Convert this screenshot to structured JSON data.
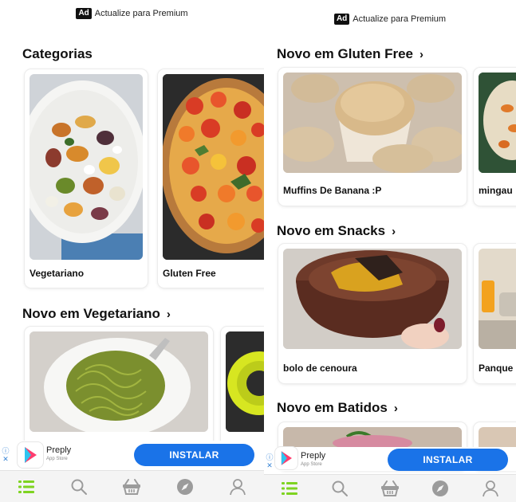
{
  "left": {
    "ad_top": {
      "badge": "Ad",
      "text": "Actualize para Premium"
    },
    "categories_title": "Categorias",
    "categories": [
      {
        "label": "Vegetariano"
      },
      {
        "label": "Gluten Free"
      }
    ],
    "vegetarian_title": "Novo em Vegetariano",
    "ad_bottom": {
      "app_name": "Preply",
      "store": "App Store",
      "install": "INSTALAR"
    }
  },
  "right": {
    "ad_top": {
      "badge": "Ad",
      "text": "Actualize para Premium"
    },
    "sections": [
      {
        "title": "Novo em Gluten Free",
        "items": [
          "Muffins De Banana :P",
          "mingau"
        ]
      },
      {
        "title": "Novo em Snacks",
        "items": [
          "bolo de cenoura",
          "Panque"
        ]
      },
      {
        "title": "Novo em Batidos",
        "items": []
      }
    ],
    "ad_bottom": {
      "app_name": "Preply",
      "store": "App Store",
      "install": "INSTALAR"
    }
  },
  "icons": [
    "list-icon",
    "search-icon",
    "basket-icon",
    "compass-icon",
    "profile-icon"
  ],
  "colors": {
    "accent": "#7ed321",
    "install": "#1a73e8",
    "nav_icon": "#9b9b9b"
  }
}
